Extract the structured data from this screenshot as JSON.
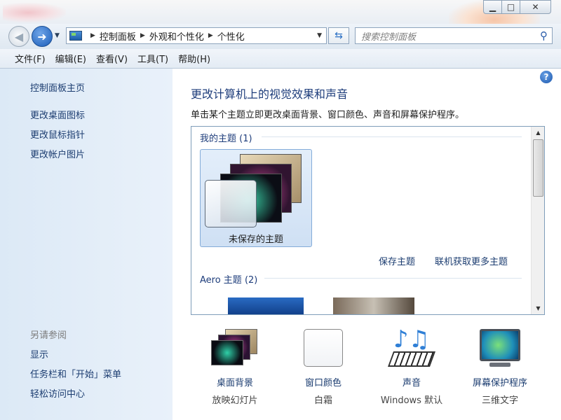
{
  "window": {
    "minimize": "▁",
    "maximize": "□",
    "close": "✕"
  },
  "address": {
    "crumbs": [
      "控制面板",
      "外观和个性化",
      "个性化"
    ]
  },
  "search": {
    "placeholder": "搜索控制面板"
  },
  "menu": [
    "文件(F)",
    "编辑(E)",
    "查看(V)",
    "工具(T)",
    "帮助(H)"
  ],
  "sidebar": {
    "home": "控制面板主页",
    "links": [
      "更改桌面图标",
      "更改鼠标指针",
      "更改帐户图片"
    ],
    "see_also_heading": "另请参阅",
    "see_also": [
      "显示",
      "任务栏和「开始」菜单",
      "轻松访问中心"
    ]
  },
  "main": {
    "title": "更改计算机上的视觉效果和声音",
    "description": "单击某个主题立即更改桌面背景、窗口颜色、声音和屏幕保护程序。",
    "my_themes_header": "我的主题 (1)",
    "unsaved_theme_label": "未保存的主题",
    "save_theme_link": "保存主题",
    "get_more_link": "联机获取更多主题",
    "aero_header": "Aero 主题 (2)"
  },
  "settings": [
    {
      "label": "桌面背景",
      "value": "放映幻灯片",
      "icon": "desktop-background-icon"
    },
    {
      "label": "窗口颜色",
      "value": "白霜",
      "icon": "window-color-icon"
    },
    {
      "label": "声音",
      "value": "Windows 默认",
      "icon": "sound-icon"
    },
    {
      "label": "屏幕保护程序",
      "value": "三维文字",
      "icon": "screensaver-icon"
    }
  ]
}
